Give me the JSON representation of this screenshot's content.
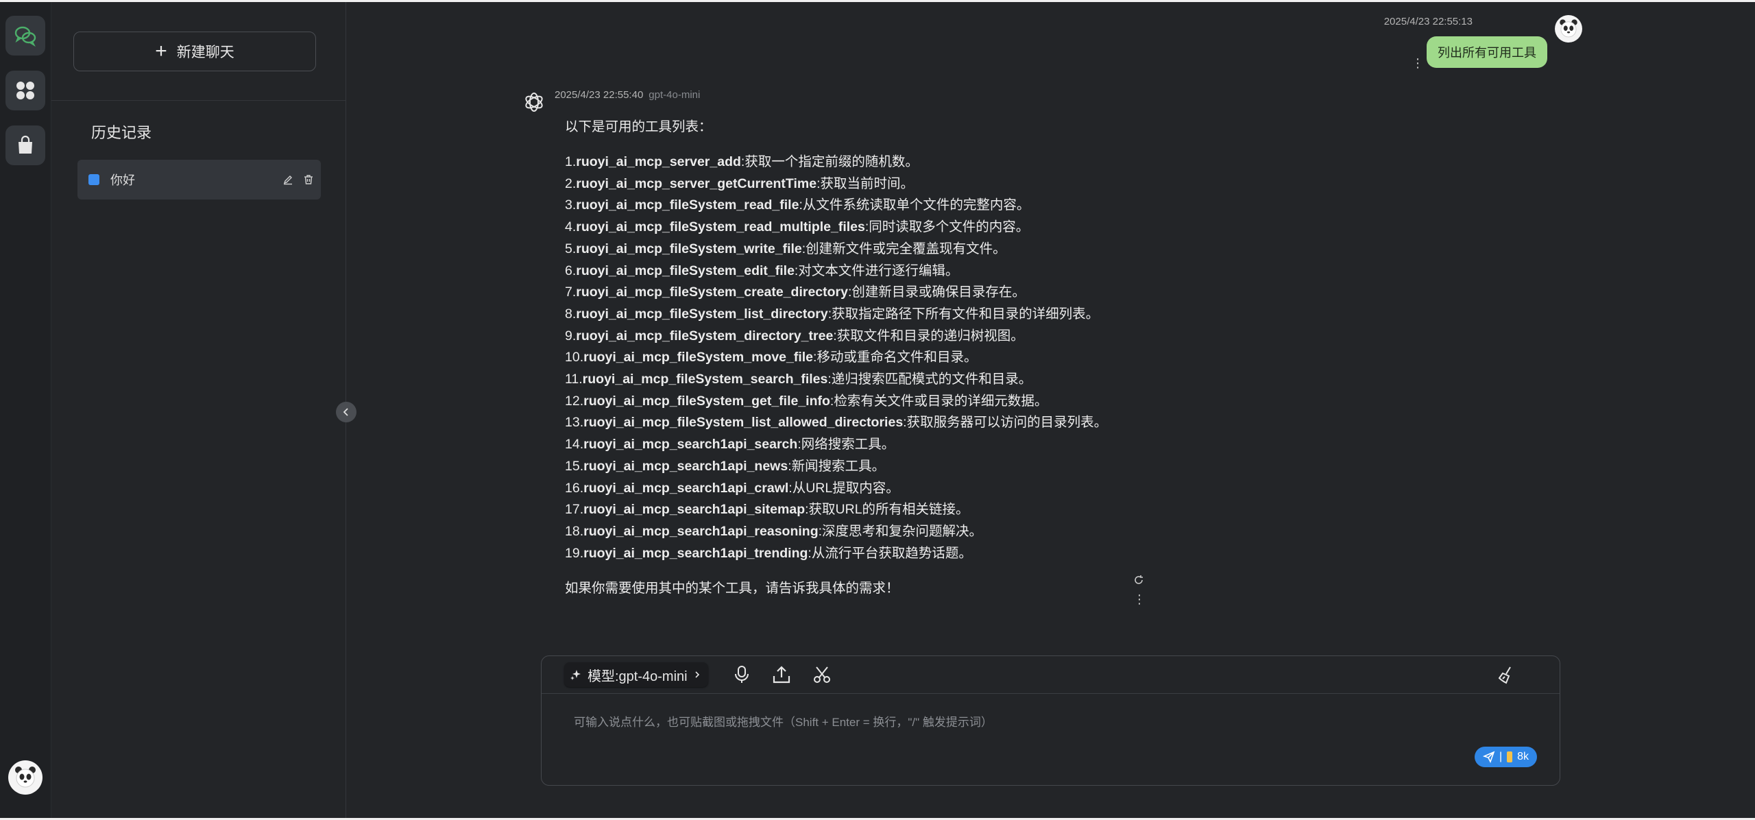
{
  "sidebar": {
    "new_chat_label": "新建聊天",
    "history_title": "历史记录",
    "history_items": [
      {
        "label": "你好"
      }
    ]
  },
  "user_message": {
    "timestamp": "2025/4/23 22:55:13",
    "text": "列出所有可用工具"
  },
  "assistant_message": {
    "timestamp": "2025/4/23 22:55:40",
    "model": "gpt-4o-mini",
    "intro": "以下是可用的工具列表：",
    "tools": [
      {
        "index": "1.",
        "name": "ruoyi_ai_mcp_server_add",
        "desc": ":获取一个指定前缀的随机数。"
      },
      {
        "index": "2.",
        "name": "ruoyi_ai_mcp_server_getCurrentTime",
        "desc": ":获取当前时间。"
      },
      {
        "index": "3.",
        "name": "ruoyi_ai_mcp_fileSystem_read_file",
        "desc": ":从文件系统读取单个文件的完整内容。"
      },
      {
        "index": "4.",
        "name": "ruoyi_ai_mcp_fileSystem_read_multiple_files",
        "desc": ":同时读取多个文件的内容。"
      },
      {
        "index": "5.",
        "name": "ruoyi_ai_mcp_fileSystem_write_file",
        "desc": ":创建新文件或完全覆盖现有文件。"
      },
      {
        "index": "6.",
        "name": "ruoyi_ai_mcp_fileSystem_edit_file",
        "desc": ":对文本文件进行逐行编辑。"
      },
      {
        "index": "7.",
        "name": "ruoyi_ai_mcp_fileSystem_create_directory",
        "desc": ":创建新目录或确保目录存在。"
      },
      {
        "index": "8.",
        "name": "ruoyi_ai_mcp_fileSystem_list_directory",
        "desc": ":获取指定路径下所有文件和目录的详细列表。"
      },
      {
        "index": "9.",
        "name": "ruoyi_ai_mcp_fileSystem_directory_tree",
        "desc": ":获取文件和目录的递归树视图。"
      },
      {
        "index": "10.",
        "name": "ruoyi_ai_mcp_fileSystem_move_file",
        "desc": ":移动或重命名文件和目录。"
      },
      {
        "index": "11.",
        "name": "ruoyi_ai_mcp_fileSystem_search_files",
        "desc": ":递归搜索匹配模式的文件和目录。"
      },
      {
        "index": "12.",
        "name": "ruoyi_ai_mcp_fileSystem_get_file_info",
        "desc": ":检索有关文件或目录的详细元数据。"
      },
      {
        "index": "13.",
        "name": "ruoyi_ai_mcp_fileSystem_list_allowed_directories",
        "desc": ":获取服务器可以访问的目录列表。"
      },
      {
        "index": "14.",
        "name": "ruoyi_ai_mcp_search1api_search",
        "desc": ":网络搜索工具。"
      },
      {
        "index": "15.",
        "name": "ruoyi_ai_mcp_search1api_news",
        "desc": ":新闻搜索工具。"
      },
      {
        "index": "16.",
        "name": "ruoyi_ai_mcp_search1api_crawl",
        "desc": ":从URL提取内容。"
      },
      {
        "index": "17.",
        "name": "ruoyi_ai_mcp_search1api_sitemap",
        "desc": ":获取URL的所有相关链接。"
      },
      {
        "index": "18.",
        "name": "ruoyi_ai_mcp_search1api_reasoning",
        "desc": ":深度思考和复杂问题解决。"
      },
      {
        "index": "19.",
        "name": "ruoyi_ai_mcp_search1api_trending",
        "desc": ":从流行平台获取趋势话题。"
      }
    ],
    "outro": "如果你需要使用其中的某个工具，请告诉我具体的需求！"
  },
  "composer": {
    "model_label": "模型:gpt-4o-mini",
    "placeholder": "可输入说点什么，也可贴截图或拖拽文件（Shift + Enter = 换行，\"/\" 触发提示词）",
    "send_counter": "8k"
  },
  "colors": {
    "background": "#232528",
    "user_bubble": "#9fd98a",
    "accent_blue": "#2f86e6",
    "history_dot": "#3d8ef0",
    "rail_active_icon": "#4caf6a"
  },
  "icons": {
    "rail": [
      "chat-icon",
      "apps-icon",
      "bag-icon"
    ],
    "toolbar": [
      "sparkle-icon",
      "microphone-icon",
      "upload-icon",
      "scissors-icon",
      "broom-icon"
    ]
  }
}
